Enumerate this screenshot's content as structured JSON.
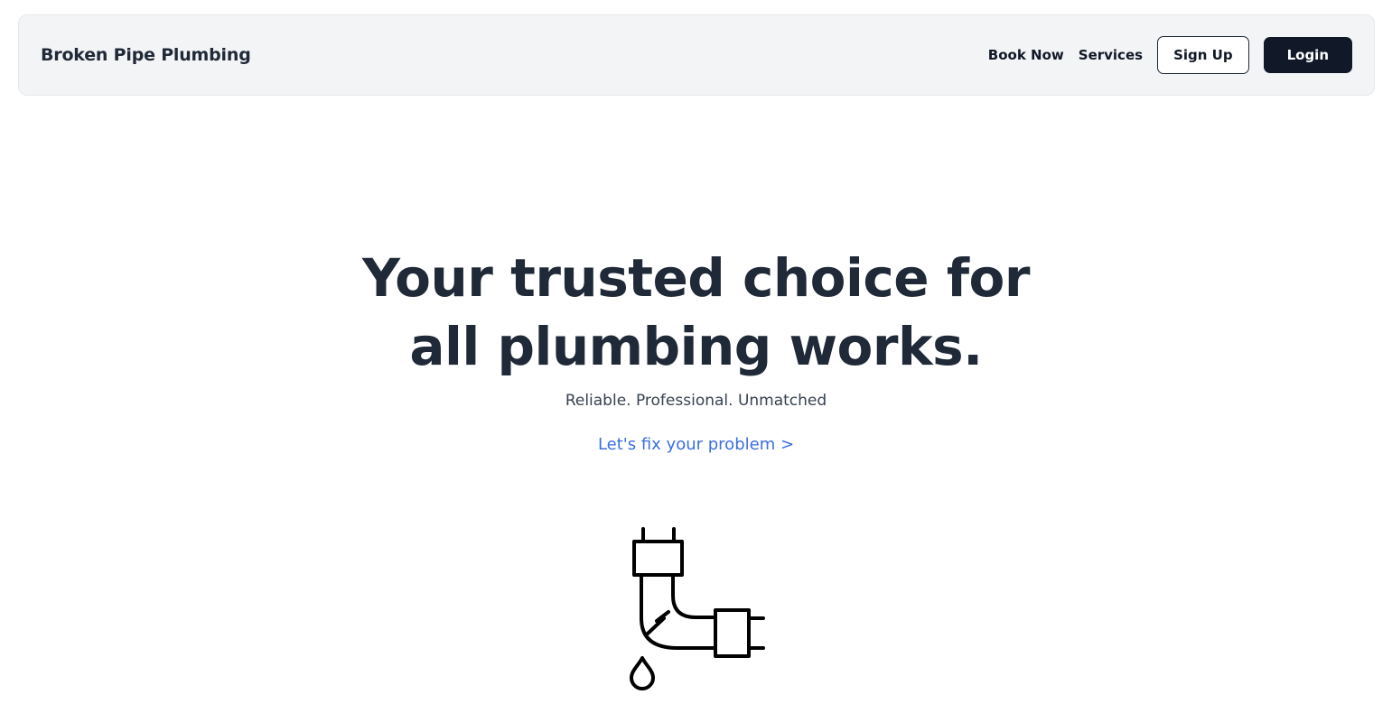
{
  "header": {
    "brand": "Broken Pipe Plumbing",
    "nav": {
      "book_now": "Book Now",
      "services": "Services"
    },
    "sign_up_label": "Sign Up",
    "login_label": "Login"
  },
  "hero": {
    "title": "Your trusted choice for all plumbing works.",
    "subtitle": "Reliable. Professional. Unmatched",
    "cta": "Let's fix your problem >"
  },
  "illustration": {
    "icon": "broken-pipe-icon"
  },
  "colors": {
    "nav_background": "#f3f4f6",
    "heading": "#1f2937",
    "primary_button": "#111827",
    "link": "#3b6fe0"
  }
}
